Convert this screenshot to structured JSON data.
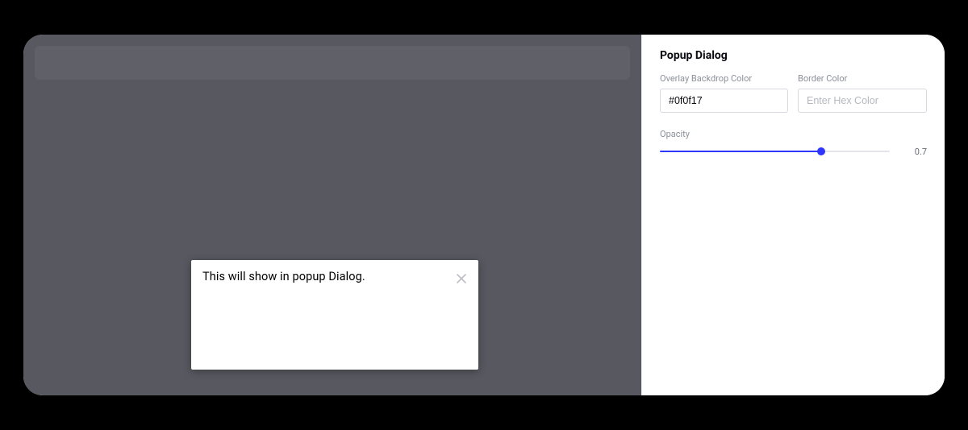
{
  "preview": {
    "popup_text": "This will show in popup Dialog."
  },
  "sidebar": {
    "title": "Popup Dialog",
    "backdrop": {
      "label": "Overlay Backdrop Color",
      "value": "#0f0f17",
      "swatch": "#0f0f17"
    },
    "border": {
      "label": "Border Color",
      "placeholder": "Enter Hex Color",
      "value": ""
    },
    "opacity": {
      "label": "Opacity",
      "value": 0.7,
      "display": "0.7",
      "min": 0,
      "max": 1
    }
  },
  "colors": {
    "accent": "#2f37ff"
  }
}
